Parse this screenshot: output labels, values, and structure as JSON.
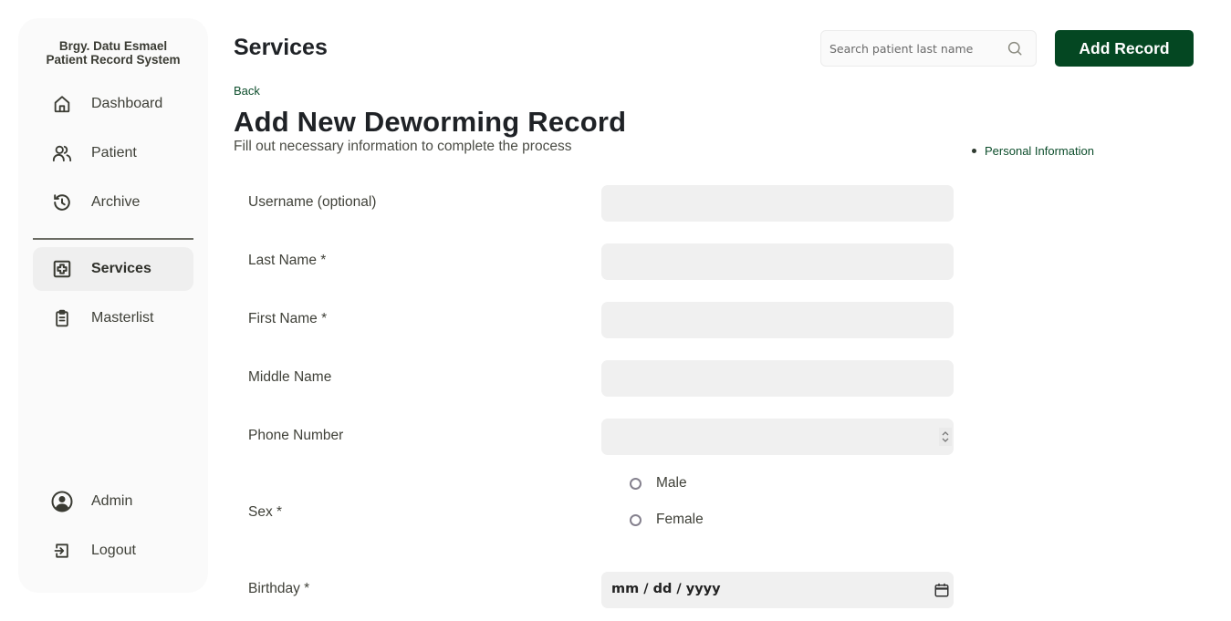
{
  "sidebar": {
    "brand_line1": "Brgy. Datu Esmael",
    "brand_line2": "Patient Record System",
    "nav_items": [
      {
        "label": "Dashboard",
        "icon": "home-icon"
      },
      {
        "label": "Patient",
        "icon": "users-icon"
      },
      {
        "label": "Archive",
        "icon": "history-icon"
      },
      {
        "label": "Services",
        "icon": "medical-plus-icon",
        "active": true
      },
      {
        "label": "Masterlist",
        "icon": "clipboard-icon"
      }
    ],
    "bottom_items": [
      {
        "label": "Admin",
        "icon": "user-circle-icon"
      },
      {
        "label": "Logout",
        "icon": "logout-icon"
      }
    ]
  },
  "header": {
    "title": "Services",
    "search_placeholder": "Search patient last name",
    "add_record_label": "Add Record"
  },
  "form": {
    "back_label": "Back",
    "title": "Add New Deworming Record",
    "subtitle": "Fill out necessary information to complete the process",
    "toc": [
      "Personal Information"
    ],
    "fields": [
      {
        "label": "Username (optional)",
        "value": ""
      },
      {
        "label": "Last Name *",
        "value": ""
      },
      {
        "label": "First Name *",
        "value": ""
      },
      {
        "label": "Middle Name",
        "value": ""
      },
      {
        "label": "Phone Number",
        "value": ""
      }
    ],
    "sex": {
      "label": "Sex *",
      "options": [
        "Male",
        "Female"
      ],
      "selected": null
    },
    "birthday": {
      "label": "Birthday *",
      "placeholder": "mm / dd / yyyy"
    }
  },
  "colors": {
    "brand": "#044722",
    "link": "#0c4d2b",
    "sidebar_bg": "#fafafa",
    "field_bg": "#f0f0f0"
  }
}
